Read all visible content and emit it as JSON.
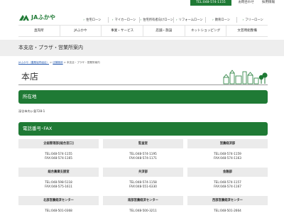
{
  "topbar": {
    "tel": "TEL:048-574-1155",
    "contact": "お問合わせ",
    "recruit": "採用情報"
  },
  "logo": {
    "text": "JAふかや"
  },
  "loan_nav": [
    {
      "label": "住宅ローン"
    },
    {
      "label": "マイカーローン"
    },
    {
      "label": "住宅所有者向けローン"
    },
    {
      "label": "リフォームローン"
    },
    {
      "label": "教育ローン"
    },
    {
      "label": "フリーローン"
    }
  ],
  "main_nav": [
    {
      "label": "直売所"
    },
    {
      "label": "JAふかや"
    },
    {
      "label": "事業・サービス"
    },
    {
      "label": "店舗・施設"
    },
    {
      "label": "ネットショッピング"
    },
    {
      "label": "文芸用組整備"
    }
  ],
  "page_title": "本支店・プラザ・営業所案内",
  "breadcrumb": {
    "home": "JAふかや（農業協同組合）",
    "sep1": " > ",
    "parent": "店舗施設",
    "sep2": " > ",
    "current": "本支店・プラザ・営業所案内"
  },
  "heading": "本店",
  "sections": {
    "address_title": "所在地",
    "tel_title": "電話番号･FAX"
  },
  "address": "深谷市内ヶ島728-1",
  "departments": [
    {
      "name": "企画管理部[総合窓口]",
      "tel": "TEL:048-574-1155",
      "fax": "FAX:048-574-1165"
    },
    {
      "name": "監査室",
      "tel": "TEL:048-574-1195",
      "fax": "FAX:048-574-1171"
    },
    {
      "name": "営農経済部",
      "tel": "TEL:048-574-1159",
      "fax": "FAX:048-574-1163"
    },
    {
      "name": "総合農業支援室",
      "tel": "TEL:048-598-5118",
      "fax": "FAX:048-575-1611"
    },
    {
      "name": "共済部",
      "tel": "TEL:048-574-1158",
      "fax": "FAX:048-551-6330"
    },
    {
      "name": "金融部",
      "tel": "TEL:048-574-1157",
      "fax": "FAX:048-574-1167"
    },
    {
      "name": "北部営農経済センター",
      "tel": "TEL:048-501-0368",
      "fax": ""
    },
    {
      "name": "南部営農経済センター",
      "tel": "TEL:048-500-3211",
      "fax": ""
    },
    {
      "name": "西部営農経済センター",
      "tel": "TEL:048-501-2664",
      "fax": ""
    }
  ]
}
